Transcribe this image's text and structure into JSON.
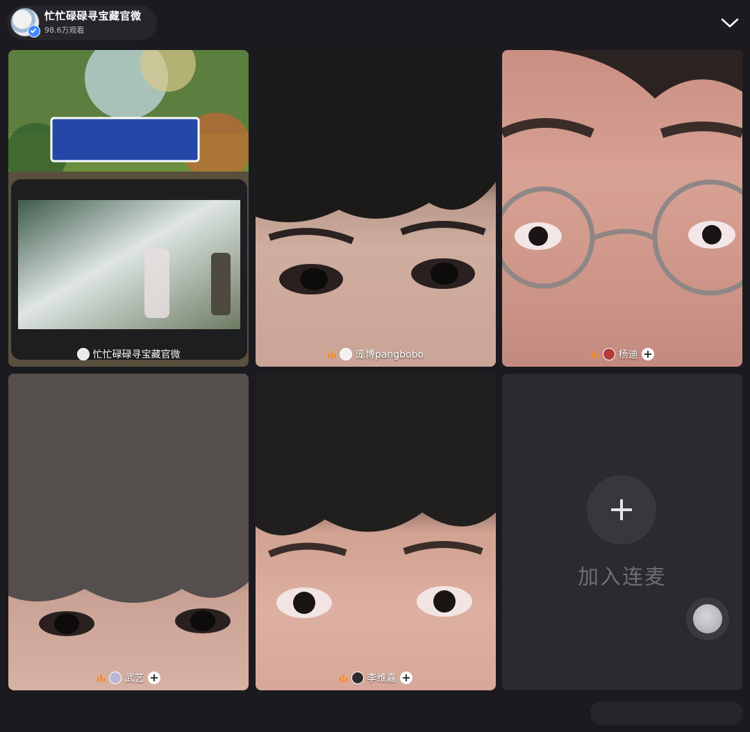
{
  "header": {
    "host_name": "忙忙碌碌寻宝藏官微",
    "viewer_count": "98.6万观看",
    "collapse_icon": "chevron-down-icon"
  },
  "tiles": [
    {
      "name": "忙忙碌碌寻宝藏官微",
      "has_mic": false,
      "has_follow": false
    },
    {
      "name": "庞博pangbobo",
      "has_mic": true,
      "has_follow": false
    },
    {
      "name": "杨迪",
      "has_mic": true,
      "has_follow": true
    },
    {
      "name": "武艺",
      "has_mic": true,
      "has_follow": true
    },
    {
      "name": "李维嘉",
      "has_mic": true,
      "has_follow": true
    }
  ],
  "join": {
    "label": "加入连麦",
    "icon": "plus-icon"
  },
  "colors": {
    "background": "#1b1a1f",
    "mic_orange": "#ff8a1f",
    "verified_blue": "#3d8bff"
  }
}
